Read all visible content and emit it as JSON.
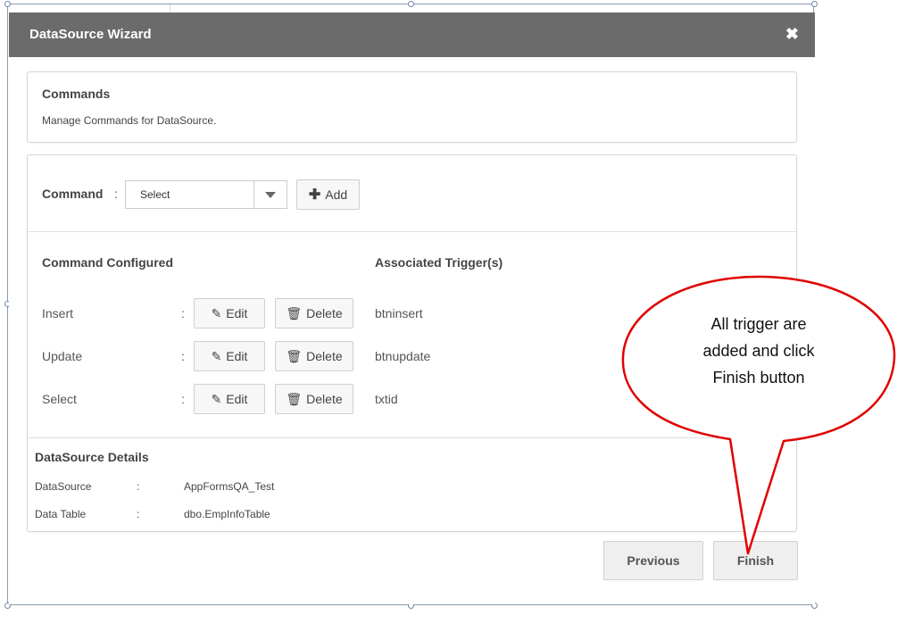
{
  "dialog": {
    "title": "DataSource Wizard",
    "close_icon": "close-icon"
  },
  "commands_panel": {
    "heading": "Commands",
    "description": "Manage Commands for DataSource."
  },
  "command_row": {
    "label": "Command",
    "separator": ":",
    "select_value": "Select",
    "add_label": "Add"
  },
  "table": {
    "col1": "Command Configured",
    "col2": "Associated Trigger(s)",
    "rows": [
      {
        "name": "Insert",
        "sep": ":",
        "edit": "Edit",
        "delete": "Delete",
        "trigger": "btninsert"
      },
      {
        "name": "Update",
        "sep": ":",
        "edit": "Edit",
        "delete": "Delete",
        "trigger": "btnupdate"
      },
      {
        "name": "Select",
        "sep": ":",
        "edit": "Edit",
        "delete": "Delete",
        "trigger": "txtid"
      }
    ]
  },
  "details": {
    "heading": "DataSource Details",
    "rows": [
      {
        "label": "DataSource",
        "sep": ":",
        "value": "AppFormsQA_Test"
      },
      {
        "label": "Data Table",
        "sep": ":",
        "value": "dbo.EmpInfoTable"
      }
    ]
  },
  "footer": {
    "previous": "Previous",
    "finish": "Finish"
  },
  "callout": {
    "line1": "All trigger are",
    "line2": "added and click",
    "line3": "Finish button",
    "color": "#e00000"
  },
  "colors": {
    "titlebar": "#6b6b6b",
    "border": "#d6d6d6"
  }
}
